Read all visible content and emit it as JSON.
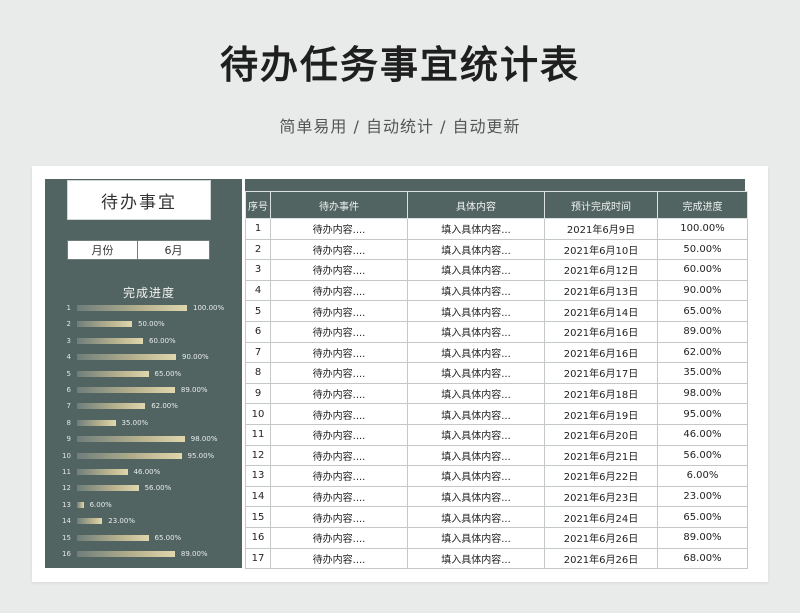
{
  "title": "待办任务事宜统计表",
  "subtitle": "简单易用 / 自动统计 / 自动更新",
  "panel": {
    "title": "待办事宜",
    "month_label": "月份",
    "month_value": "6月",
    "progress_title": "完成进度"
  },
  "table": {
    "headers": [
      "序号",
      "待办事件",
      "具体内容",
      "预计完成时间",
      "完成进度"
    ],
    "rows": [
      [
        "1",
        "待办内容....",
        "填入具体内容...",
        "2021年6月9日",
        "100.00%"
      ],
      [
        "2",
        "待办内容....",
        "填入具体内容...",
        "2021年6月10日",
        "50.00%"
      ],
      [
        "3",
        "待办内容....",
        "填入具体内容...",
        "2021年6月12日",
        "60.00%"
      ],
      [
        "4",
        "待办内容....",
        "填入具体内容...",
        "2021年6月13日",
        "90.00%"
      ],
      [
        "5",
        "待办内容....",
        "填入具体内容...",
        "2021年6月14日",
        "65.00%"
      ],
      [
        "6",
        "待办内容....",
        "填入具体内容...",
        "2021年6月16日",
        "89.00%"
      ],
      [
        "7",
        "待办内容....",
        "填入具体内容...",
        "2021年6月16日",
        "62.00%"
      ],
      [
        "8",
        "待办内容....",
        "填入具体内容...",
        "2021年6月17日",
        "35.00%"
      ],
      [
        "9",
        "待办内容....",
        "填入具体内容...",
        "2021年6月18日",
        "98.00%"
      ],
      [
        "10",
        "待办内容....",
        "填入具体内容...",
        "2021年6月19日",
        "95.00%"
      ],
      [
        "11",
        "待办内容....",
        "填入具体内容...",
        "2021年6月20日",
        "46.00%"
      ],
      [
        "12",
        "待办内容....",
        "填入具体内容...",
        "2021年6月21日",
        "56.00%"
      ],
      [
        "13",
        "待办内容....",
        "填入具体内容...",
        "2021年6月22日",
        "6.00%"
      ],
      [
        "14",
        "待办内容....",
        "填入具体内容...",
        "2021年6月23日",
        "23.00%"
      ],
      [
        "15",
        "待办内容....",
        "填入具体内容...",
        "2021年6月24日",
        "65.00%"
      ],
      [
        "16",
        "待办内容....",
        "填入具体内容...",
        "2021年6月26日",
        "89.00%"
      ],
      [
        "17",
        "待办内容....",
        "填入具体内容...",
        "2021年6月26日",
        "68.00%"
      ]
    ]
  },
  "chart_data": {
    "type": "bar",
    "title": "完成进度",
    "categories": [
      "1",
      "2",
      "3",
      "4",
      "5",
      "6",
      "7",
      "8",
      "9",
      "10",
      "11",
      "12",
      "13",
      "14",
      "15",
      "16"
    ],
    "values": [
      100,
      50,
      60,
      90,
      65,
      89,
      62,
      35,
      98,
      95,
      46,
      56,
      6,
      23,
      65,
      89
    ],
    "value_labels": [
      "100.00%",
      "50.00%",
      "60.00%",
      "90.00%",
      "65.00%",
      "89.00%",
      "62.00%",
      "35.00%",
      "98.00%",
      "95.00%",
      "46.00%",
      "56.00%",
      "6.00%",
      "23.00%",
      "65.00%",
      "89.00%"
    ],
    "xlim": [
      0,
      100
    ],
    "orientation": "horizontal",
    "grid": false
  },
  "colors": {
    "panel": "#526461",
    "bar_start": "#6f7e7b",
    "bar_end": "#e0d7ad"
  }
}
